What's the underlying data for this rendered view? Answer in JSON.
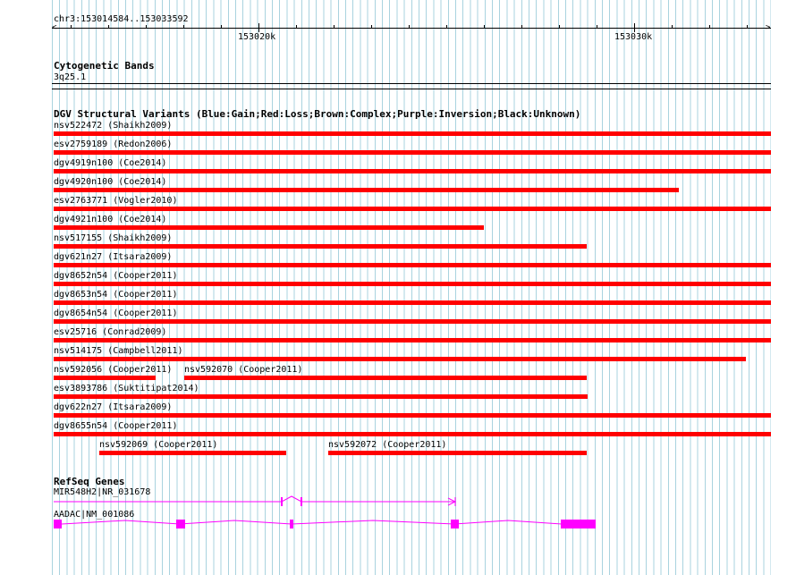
{
  "ruler": {
    "range_label": "chr3:153014584..153033592",
    "major_ticks": [
      "153020k",
      "153030k"
    ]
  },
  "cytoband": {
    "title": "Cytogenetic Bands",
    "band": "3q25.1"
  },
  "dgv": {
    "title": "DGV Structural Variants (Blue:Gain;Red:Loss;Brown:Complex;Purple:Inversion;Black:Unknown)",
    "loss_color": "#ff0000",
    "rows": [
      {
        "features": [
          {
            "label": "nsv522472 (Shaikh2009)"
          }
        ]
      },
      {
        "features": [
          {
            "label": "esv2759189 (Redon2006)"
          }
        ]
      },
      {
        "features": [
          {
            "label": "dgv4919n100 (Coe2014)"
          }
        ]
      },
      {
        "features": [
          {
            "label": "dgv4920n100 (Coe2014)"
          }
        ]
      },
      {
        "features": [
          {
            "label": "esv2763771 (Vogler2010)"
          }
        ]
      },
      {
        "features": [
          {
            "label": "dgv4921n100 (Coe2014)"
          }
        ]
      },
      {
        "features": [
          {
            "label": "nsv517155 (Shaikh2009)"
          }
        ]
      },
      {
        "features": [
          {
            "label": "dgv621n27 (Itsara2009)"
          }
        ]
      },
      {
        "features": [
          {
            "label": "dgv8652n54 (Cooper2011)"
          }
        ]
      },
      {
        "features": [
          {
            "label": "dgv8653n54 (Cooper2011)"
          }
        ]
      },
      {
        "features": [
          {
            "label": "dgv8654n54 (Cooper2011)"
          }
        ]
      },
      {
        "features": [
          {
            "label": "esv25716 (Conrad2009)"
          }
        ]
      },
      {
        "features": [
          {
            "label": "nsv514175 (Campbell2011)"
          }
        ]
      },
      {
        "features": [
          {
            "label": "nsv592056 (Cooper2011)"
          },
          {
            "label": "nsv592070 (Cooper2011)"
          }
        ]
      },
      {
        "features": [
          {
            "label": "esv3893786 (Suktitipat2014)"
          }
        ]
      },
      {
        "features": [
          {
            "label": "dgv622n27 (Itsara2009)"
          }
        ]
      },
      {
        "features": [
          {
            "label": "dgv8655n54 (Cooper2011)"
          }
        ]
      },
      {
        "features": [
          {
            "label": "nsv592069 (Cooper2011)"
          },
          {
            "label": "nsv592072 (Cooper2011)"
          }
        ]
      }
    ]
  },
  "refseq": {
    "title": "RefSeq Genes",
    "gene_color": "#ff00ff",
    "genes": [
      {
        "label": "MIR548H2|NR_031678"
      },
      {
        "label": "AADAC|NM_001086"
      }
    ]
  }
}
